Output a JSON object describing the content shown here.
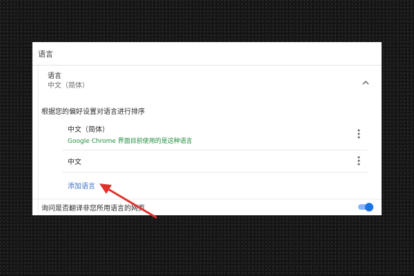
{
  "section": {
    "title": "语言"
  },
  "language_card": {
    "title": "语言",
    "current": "中文（简体）",
    "collapse_icon": "chevron-up-icon"
  },
  "order_description": "根据您的偏好设置对语言进行排序",
  "languages": [
    {
      "name": "中文（简体）",
      "note": "Google Chrome 界面目前使用的是这种语言",
      "menu_icon": "more-vert-icon"
    },
    {
      "name": "中文",
      "menu_icon": "more-vert-icon"
    }
  ],
  "add_language_label": "添加语言",
  "translate_offer": {
    "label": "询问是否翻译非您所用语言的网页",
    "enabled": true
  },
  "colors": {
    "link": "#3b73c8",
    "note_green": "#1e8e3e",
    "toggle_on": "#1a73e8",
    "annotation_arrow": "#e0302a"
  }
}
